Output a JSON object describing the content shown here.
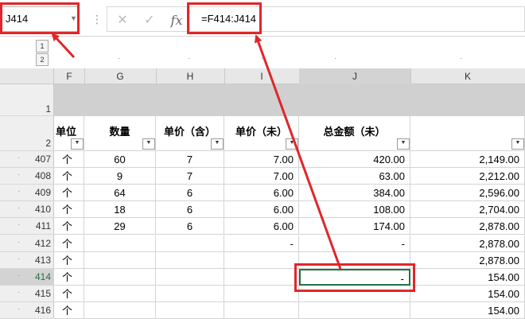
{
  "formula_bar": {
    "name_box": "J414",
    "formula": "=F414:J414"
  },
  "outline": {
    "level_rows": [
      "1",
      "2"
    ],
    "level_cols": [
      "1",
      "2"
    ]
  },
  "columns": [
    "F",
    "G",
    "H",
    "I",
    "J",
    "K"
  ],
  "header_rows": {
    "row1_num": "1",
    "row2_num": "2",
    "labels": [
      "单位",
      "数量",
      "单价（含）",
      "单价（未）",
      "总金额（未）",
      ""
    ]
  },
  "rows": [
    {
      "num": "407",
      "F": "个",
      "G": "60",
      "H": "7",
      "I": "7.00",
      "J": "420.00",
      "K": "2,149.00"
    },
    {
      "num": "408",
      "F": "个",
      "G": "9",
      "H": "7",
      "I": "7.00",
      "J": "63.00",
      "K": "2,212.00"
    },
    {
      "num": "409",
      "F": "个",
      "G": "64",
      "H": "6",
      "I": "6.00",
      "J": "384.00",
      "K": "2,596.00"
    },
    {
      "num": "410",
      "F": "个",
      "G": "18",
      "H": "6",
      "I": "6.00",
      "J": "108.00",
      "K": "2,704.00"
    },
    {
      "num": "411",
      "F": "个",
      "G": "29",
      "H": "6",
      "I": "6.00",
      "J": "174.00",
      "K": "2,878.00"
    },
    {
      "num": "412",
      "F": "个",
      "G": "",
      "H": "",
      "I": "-",
      "J": "-",
      "K": "2,878.00"
    },
    {
      "num": "413",
      "F": "个",
      "G": "",
      "H": "",
      "I": "",
      "J": "",
      "K": "2,878.00"
    },
    {
      "num": "414",
      "F": "个",
      "G": "",
      "H": "",
      "I": "",
      "J": "-",
      "K": "154.00"
    },
    {
      "num": "415",
      "F": "个",
      "G": "",
      "H": "",
      "I": "",
      "J": "",
      "K": "154.00"
    },
    {
      "num": "416",
      "F": "个",
      "G": "",
      "H": "",
      "I": "",
      "J": "",
      "K": "154.00"
    }
  ],
  "colors": {
    "accent": "#e0262a",
    "selection": "#217346"
  }
}
